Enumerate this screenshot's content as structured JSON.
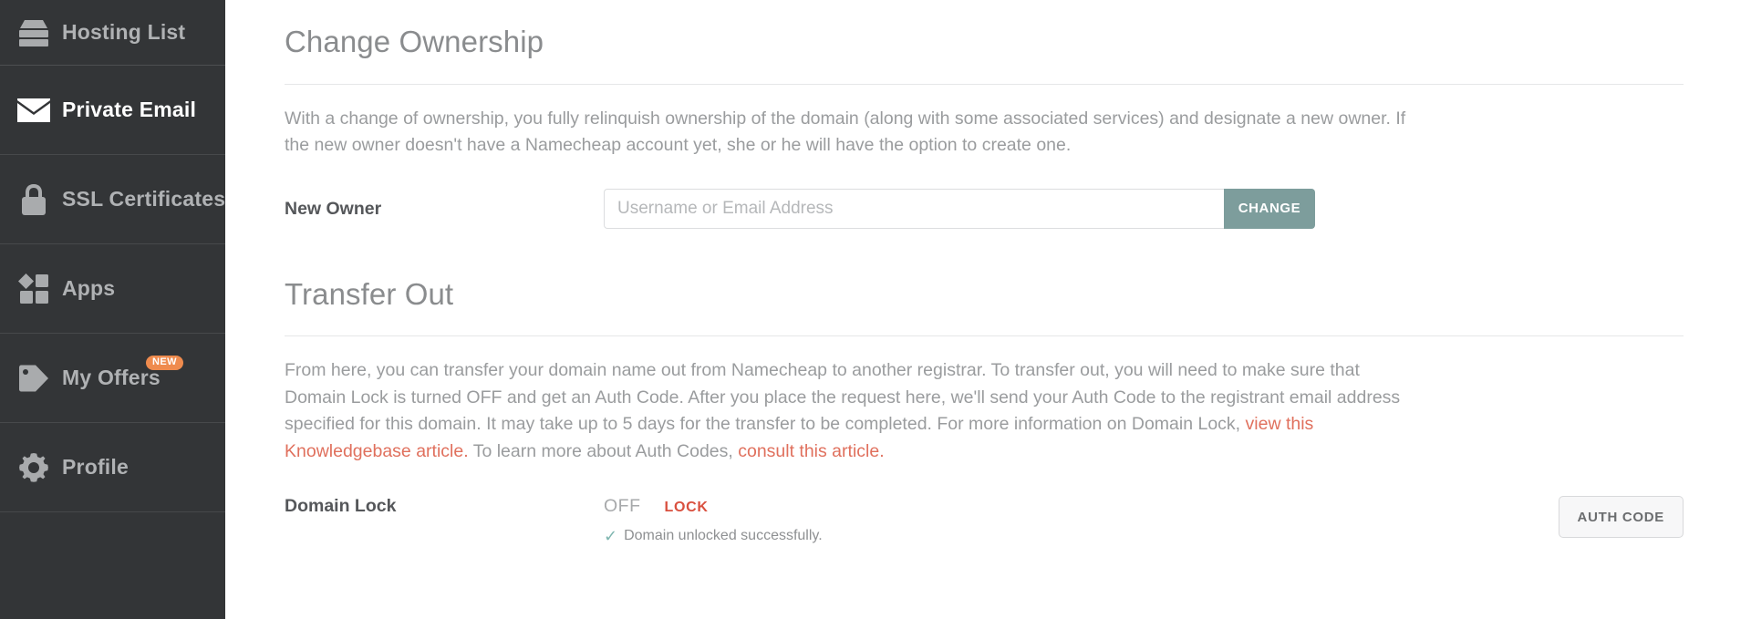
{
  "sidebar": {
    "items": [
      {
        "label": "Hosting List",
        "icon": "server-rack-icon",
        "active": false,
        "badge": null
      },
      {
        "label": "Private Email",
        "icon": "envelope-icon",
        "active": true,
        "badge": null
      },
      {
        "label": "SSL Certificates",
        "icon": "padlock-icon",
        "active": false,
        "badge": null
      },
      {
        "label": "Apps",
        "icon": "apps-grid-icon",
        "active": false,
        "badge": null
      },
      {
        "label": "My Offers",
        "icon": "price-tag-icon",
        "active": false,
        "badge": "NEW"
      },
      {
        "label": "Profile",
        "icon": "gear-icon",
        "active": false,
        "badge": null
      }
    ]
  },
  "change_ownership": {
    "title": "Change Ownership",
    "description": "With a change of ownership, you fully relinquish ownership of the domain (along with some associated services) and designate a new owner. If the new owner doesn't have a Namecheap account yet, she or he will have the option to create one.",
    "field_label": "New Owner",
    "input_placeholder": "Username or Email Address",
    "input_value": "",
    "button_label": "CHANGE"
  },
  "transfer_out": {
    "title": "Transfer Out",
    "description_part1": "From here, you can transfer your domain name out from Namecheap to another registrar. To transfer out, you will need to make sure that Domain Lock is turned OFF and get an Auth Code. After you place the request here, we'll send your Auth Code to the registrant email address specified for this domain. It may take up to 5 days for the transfer to be completed. For more information on Domain Lock, ",
    "link1_text": "view this Knowledgebase article.",
    "description_part2": " To learn more about Auth Codes, ",
    "link2_text": "consult this article.",
    "domain_lock_label": "Domain Lock",
    "domain_lock_state": "OFF",
    "domain_lock_action": "LOCK",
    "domain_lock_message": "Domain unlocked successfully.",
    "check_glyph": "✓",
    "auth_code_button": "AUTH CODE"
  },
  "colors": {
    "sidebar_bg": "#333537",
    "sidebar_text": "#b0b2b4",
    "sidebar_active_text": "#ffffff",
    "badge_new": "#ef8b4e",
    "heading": "#8a8c8e",
    "body_text": "#9a9c9e",
    "link": "#e0705d",
    "change_button": "#7d9d9c",
    "lock_action": "#d9503f",
    "check": "#7fb6b0"
  }
}
